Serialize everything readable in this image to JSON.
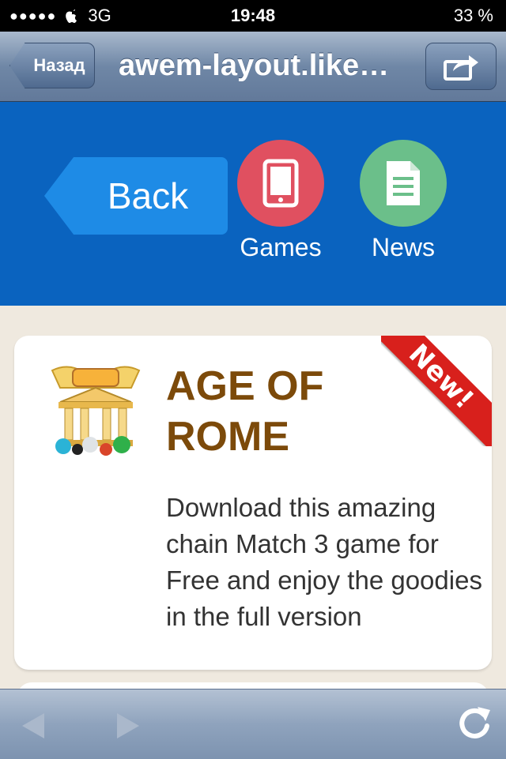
{
  "status_bar": {
    "signal": "●●●●●",
    "carrier": "3G",
    "time": "19:48",
    "battery": "33 %"
  },
  "browser": {
    "back_label": "Назад",
    "url_title": "awem-layout.like…"
  },
  "app_header": {
    "back_label": "Back",
    "games_label": "Games",
    "news_label": "News",
    "colors": {
      "header_bg": "#0a63bf",
      "back_bg": "#1e8be6",
      "games_circle": "#e05060",
      "news_circle": "#6bbf8a"
    }
  },
  "card": {
    "title": "AGE OF ROME",
    "description": "Download this amazing chain Match 3 game for Free and enjoy the goodies in the full version",
    "badge": "New!",
    "icon": "age-of-rome-icon",
    "title_color": "#7c4a0a",
    "badge_color": "#d8201c"
  },
  "toolbar": {
    "icons": [
      "back-arrow-icon",
      "forward-arrow-icon",
      "reload-icon"
    ]
  }
}
